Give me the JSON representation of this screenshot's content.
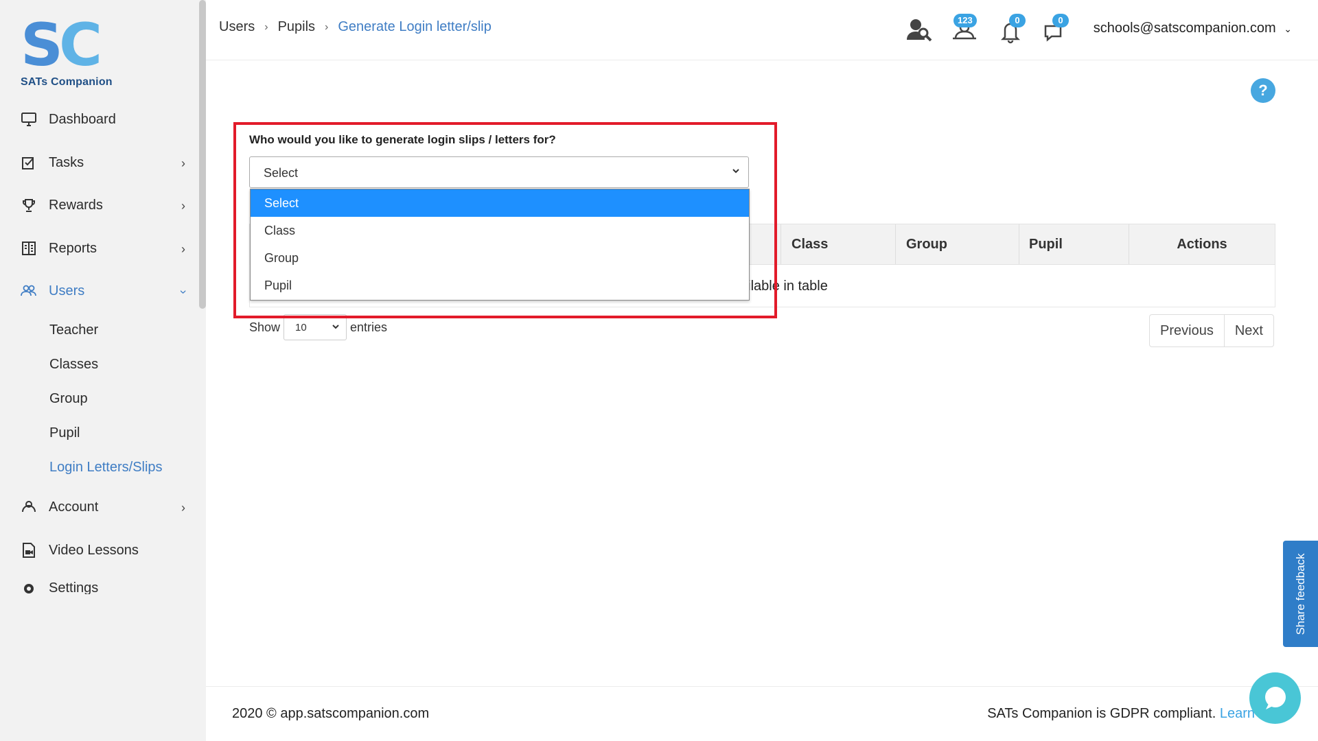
{
  "brand": {
    "logo_letters": "SC",
    "tagline": "SATs Companion"
  },
  "sidebar": {
    "items": [
      {
        "label": "Dashboard",
        "icon": "monitor-icon"
      },
      {
        "label": "Tasks",
        "icon": "checklist-icon"
      },
      {
        "label": "Rewards",
        "icon": "trophy-icon"
      },
      {
        "label": "Reports",
        "icon": "reports-icon"
      },
      {
        "label": "Users",
        "icon": "users-icon"
      },
      {
        "label": "Account",
        "icon": "account-icon"
      },
      {
        "label": "Video Lessons",
        "icon": "video-icon"
      },
      {
        "label": "Settings",
        "icon": "gear-icon"
      }
    ],
    "users_sub": [
      "Teacher",
      "Classes",
      "Group",
      "Pupil",
      "Login Letters/Slips"
    ]
  },
  "breadcrumb": {
    "items": [
      "Users",
      "Pupils",
      "Generate Login letter/slip"
    ]
  },
  "header": {
    "badges": {
      "users": "123",
      "notifications": "0",
      "messages": "0"
    },
    "user_email": "schools@satscompanion.com"
  },
  "help": "?",
  "form": {
    "question": "Who would you like to generate login slips / letters for?",
    "selected": "Select",
    "options": [
      "Select",
      "Class",
      "Group",
      "Pupil"
    ]
  },
  "table": {
    "visible_columns": [
      "Class",
      "Group",
      "Pupil",
      "Actions"
    ],
    "empty_text_visible": "ailable in table",
    "length": {
      "show_label": "Show",
      "value": "10",
      "entries_label": "entries"
    },
    "pagination": {
      "previous": "Previous",
      "next": "Next"
    }
  },
  "footer": {
    "copyright": "2020 © app.satscompanion.com",
    "gdpr": "SATs Companion is GDPR compliant.",
    "learn": "Learn"
  },
  "feedback": "Share feedback",
  "colors": {
    "accent": "#3f7dc4",
    "highlight": "#e21b2a",
    "selected_option": "#1e90ff",
    "badge": "#3aa3e3"
  }
}
